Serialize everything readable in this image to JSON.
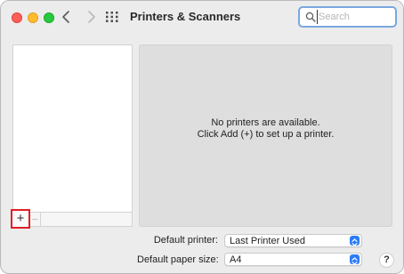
{
  "window": {
    "title": "Printers & Scanners"
  },
  "search": {
    "placeholder": "Search",
    "value": ""
  },
  "toolbar": {
    "add_label": "+",
    "remove_label": "−"
  },
  "printers": {
    "empty_line1": "No printers are available.",
    "empty_line2": "Click Add (+) to set up a printer."
  },
  "settings": {
    "default_printer_label": "Default printer:",
    "default_printer_value": "Last Printer Used",
    "default_paper_label": "Default paper size:",
    "default_paper_value": "A4"
  },
  "help": {
    "label": "?"
  },
  "icons": {
    "back": "chevron-left-icon",
    "forward": "chevron-right-icon",
    "show_all": "grid-icon",
    "search": "search-icon",
    "popup": "stepper-icon"
  },
  "colors": {
    "accent": "#2d7cf6",
    "highlight": "#e21f26",
    "close": "#fe5f57",
    "minimize": "#febc2e",
    "zoom": "#28c840"
  }
}
